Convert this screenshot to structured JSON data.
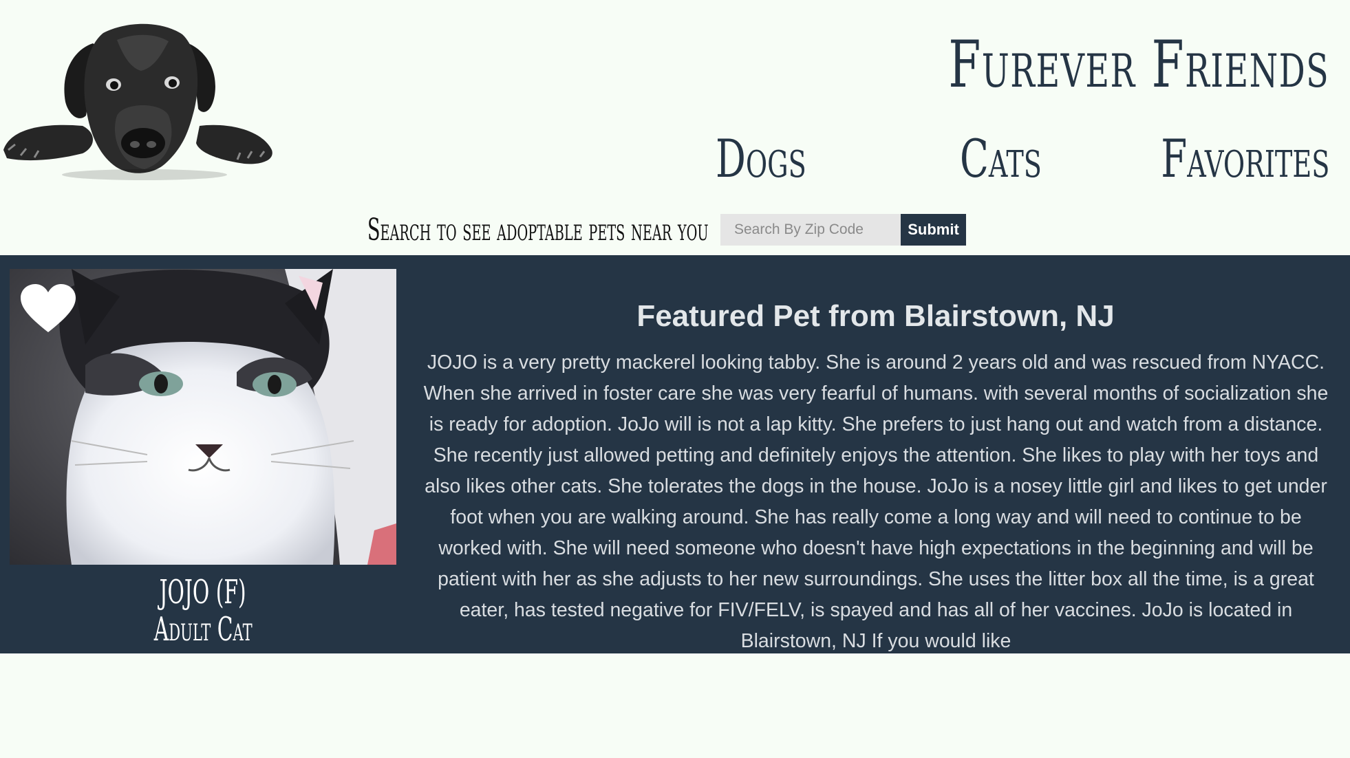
{
  "brand": {
    "name": "Furever Friends"
  },
  "nav": {
    "dogs": "Dogs",
    "cats": "Cats",
    "favorites": "Favorites"
  },
  "search": {
    "label": "Search to see adoptable pets near you",
    "placeholder": "Search By Zip Code",
    "submit_label": "Submit"
  },
  "featured": {
    "title": "Featured Pet from Blairstown, NJ",
    "pet_name": "JOJO (F)",
    "pet_type": "Adult Cat",
    "description": "JOJO is a very pretty mackerel looking tabby. She is around 2 years old and was rescued from NYACC. When she arrived in foster care she was very fearful of humans. with several months of socialization she is ready for adoption. JoJo will is not a lap kitty. She prefers to just hang out and watch from a distance. She recently just allowed petting and definitely enjoys the attention. She likes to play with her toys and also likes other cats. She tolerates the dogs in the house. JoJo is a nosey little girl and likes to get under foot when you are walking around. She has really come a long way and will need to continue to be worked with. She will need someone who doesn't have high expectations in the beginning and will be patient with her as she adjusts to her new surroundings. She uses the litter box all the time, is a great eater, has tested negative for FIV/FELV, is spayed and has all of her vaccines. JoJo is located in Blairstown, NJ If you would like"
  },
  "colors": {
    "page_background": "#f7fdf6",
    "navy": "#253545",
    "input_background": "#e5e5e5",
    "heart": "#ffffff"
  },
  "icons": {
    "logo": "black-dog-logo",
    "favorite": "heart-icon"
  }
}
